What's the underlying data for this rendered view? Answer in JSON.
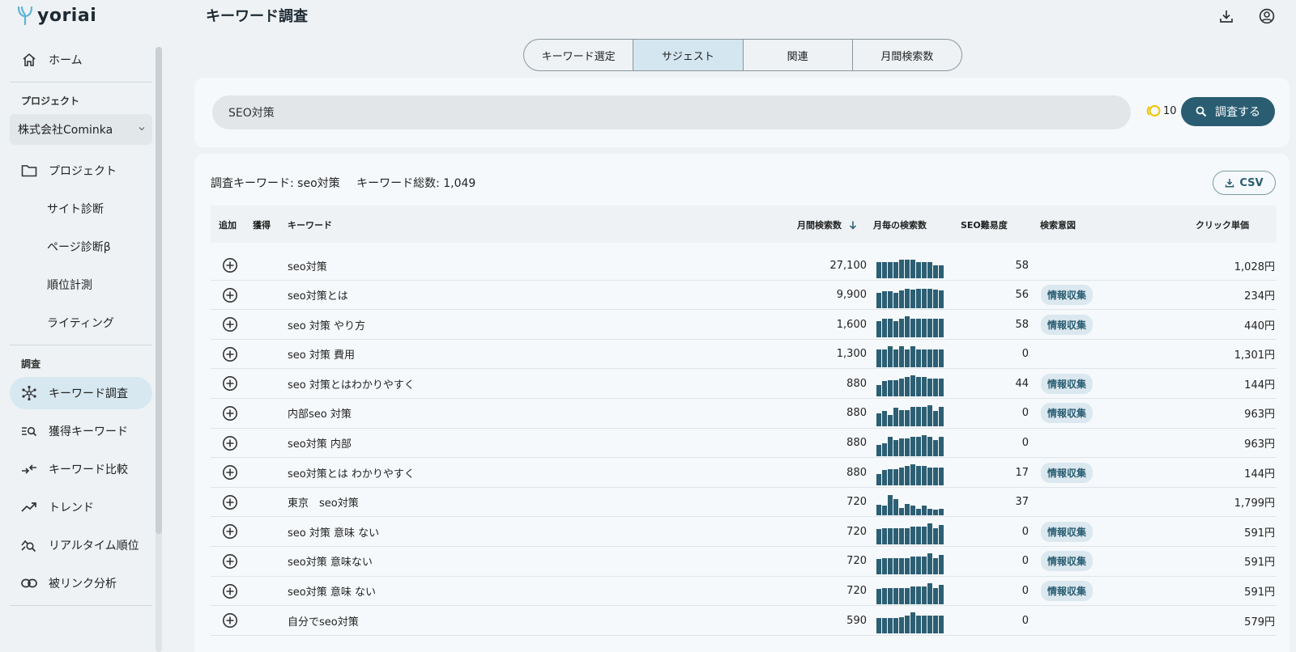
{
  "app": {
    "logo_text": "yoriai",
    "page_title": "キーワード調査"
  },
  "sidebar": {
    "home": "ホーム",
    "project_section": "プロジェクト",
    "project_select": "株式会社Cominka",
    "items": [
      {
        "label": "プロジェクト",
        "icon": "folder-icon"
      },
      {
        "label": "サイト診断"
      },
      {
        "label": "ページ診断β"
      },
      {
        "label": "順位計測"
      },
      {
        "label": "ライティング"
      }
    ],
    "research_section": "調査",
    "research_items": [
      {
        "label": "キーワード調査",
        "icon": "network-icon",
        "active": true
      },
      {
        "label": "獲得キーワード",
        "icon": "list-search-icon"
      },
      {
        "label": "キーワード比較",
        "icon": "compare-arrows-icon"
      },
      {
        "label": "トレンド",
        "icon": "trending-up-icon"
      },
      {
        "label": "リアルタイム順位",
        "icon": "chart-search-icon"
      },
      {
        "label": "被リンク分析",
        "icon": "link-icon"
      }
    ]
  },
  "tabs": [
    "キーワード選定",
    "サジェスト",
    "関連",
    "月間検索数"
  ],
  "active_tab": 1,
  "search": {
    "value": "SEO対策",
    "credits": "10",
    "button_label": "調査する"
  },
  "results": {
    "summary_keyword": "調査キーワード: seo対策",
    "summary_total": "キーワード総数: 1,049",
    "csv_label": "CSV",
    "columns": {
      "add": "追加",
      "acquired": "獲得",
      "keyword": "キーワード",
      "volume": "月間検索数",
      "trend": "月毎の検索数",
      "seo": "SEO難易度",
      "intent": "検索意図",
      "cpc": "クリック単価"
    },
    "rows": [
      {
        "keyword": "seo対策",
        "volume": "27,100",
        "seo": "58",
        "intent": "",
        "cpc": "1,028円",
        "trend": [
          0.78,
          0.78,
          0.78,
          0.78,
          0.9,
          0.9,
          0.9,
          0.78,
          0.78,
          0.78,
          0.62,
          0.62
        ]
      },
      {
        "keyword": "seo対策とは",
        "volume": "9,900",
        "seo": "56",
        "intent": "情報収集",
        "cpc": "234円",
        "trend": [
          0.72,
          0.8,
          0.82,
          0.72,
          0.85,
          0.92,
          0.9,
          0.92,
          0.92,
          0.92,
          0.9,
          0.85
        ]
      },
      {
        "keyword": "seo 対策 やり方",
        "volume": "1,600",
        "seo": "58",
        "intent": "情報収集",
        "cpc": "440円",
        "trend": [
          0.78,
          0.9,
          0.9,
          0.78,
          0.9,
          1.0,
          0.9,
          0.9,
          0.9,
          0.9,
          0.9,
          0.9
        ]
      },
      {
        "keyword": "seo 対策 費用",
        "volume": "1,300",
        "seo": "0",
        "intent": "",
        "cpc": "1,301円",
        "trend": [
          0.85,
          0.85,
          1.0,
          0.85,
          1.0,
          0.85,
          1.0,
          0.85,
          0.85,
          0.85,
          0.85,
          0.85
        ]
      },
      {
        "keyword": "seo 対策とはわかりやすく",
        "volume": "880",
        "seo": "44",
        "intent": "情報収集",
        "cpc": "144円",
        "trend": [
          0.55,
          0.72,
          0.78,
          0.78,
          0.85,
          0.92,
          1.0,
          0.92,
          0.92,
          0.85,
          0.85,
          0.85
        ]
      },
      {
        "keyword": "内部seo 対策",
        "volume": "880",
        "seo": "0",
        "intent": "情報収集",
        "cpc": "963円",
        "trend": [
          0.62,
          0.72,
          0.55,
          0.9,
          0.78,
          0.78,
          0.92,
          0.92,
          0.92,
          1.0,
          0.72,
          0.92
        ]
      },
      {
        "keyword": "seo対策 内部",
        "volume": "880",
        "seo": "0",
        "intent": "",
        "cpc": "963円",
        "trend": [
          0.55,
          0.62,
          0.92,
          0.78,
          0.85,
          0.85,
          0.92,
          0.92,
          1.0,
          0.92,
          0.78,
          0.92
        ]
      },
      {
        "keyword": "seo対策とは わかりやすく",
        "volume": "880",
        "seo": "17",
        "intent": "情報収集",
        "cpc": "144円",
        "trend": [
          0.55,
          0.72,
          0.78,
          0.78,
          0.85,
          0.92,
          1.0,
          0.92,
          0.92,
          0.85,
          0.85,
          0.85
        ]
      },
      {
        "keyword": "東京　seo対策",
        "volume": "720",
        "seo": "37",
        "intent": "",
        "cpc": "1,799円",
        "trend": [
          0.5,
          0.45,
          0.95,
          0.75,
          0.35,
          0.55,
          0.45,
          0.3,
          0.45,
          0.3,
          0.25,
          0.3
        ]
      },
      {
        "keyword": "seo 対策 意味 ない",
        "volume": "720",
        "seo": "0",
        "intent": "情報収集",
        "cpc": "591円",
        "trend": [
          0.72,
          0.78,
          0.78,
          0.78,
          0.78,
          0.78,
          0.85,
          0.85,
          0.85,
          1.0,
          0.78,
          0.92
        ]
      },
      {
        "keyword": "seo対策 意味ない",
        "volume": "720",
        "seo": "0",
        "intent": "情報収集",
        "cpc": "591円",
        "trend": [
          0.72,
          0.78,
          0.78,
          0.78,
          0.78,
          0.78,
          0.85,
          0.85,
          0.85,
          1.0,
          0.78,
          0.92
        ]
      },
      {
        "keyword": "seo対策 意味 ない",
        "volume": "720",
        "seo": "0",
        "intent": "情報収集",
        "cpc": "591円",
        "trend": [
          0.72,
          0.78,
          0.78,
          0.78,
          0.78,
          0.78,
          0.85,
          0.85,
          0.85,
          1.0,
          0.78,
          0.92
        ]
      },
      {
        "keyword": "自分でseo対策",
        "volume": "590",
        "seo": "0",
        "intent": "",
        "cpc": "579円",
        "trend": [
          0.72,
          0.72,
          0.72,
          0.72,
          0.78,
          0.85,
          1.0,
          0.85,
          0.85,
          0.85,
          0.85,
          0.85
        ]
      }
    ]
  },
  "colors": {
    "accent": "#2a5d72",
    "bar": "#2c5f73",
    "active_nav": "#d7e8f1",
    "badge_bg": "#dbe8ef"
  }
}
